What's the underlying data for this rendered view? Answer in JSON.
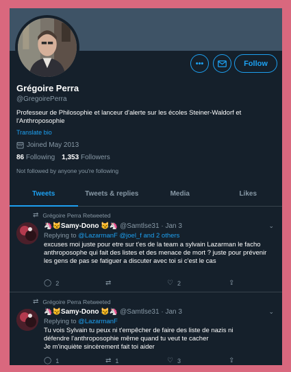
{
  "profile": {
    "display_name": "Grégoire Perra",
    "handle": "@GregoirePerra",
    "bio": "Professeur de Philosophie et lanceur d'alerte sur les écoles Steiner-Waldorf et l'Anthroposophie",
    "translate_label": "Translate bio",
    "joined": "Joined May 2013",
    "following_count": "86",
    "following_label": "Following",
    "followers_count": "1,353",
    "followers_label": "Followers",
    "not_followed": "Not followed by anyone you're following",
    "more_icon": "•••",
    "follow_label": "Follow"
  },
  "tabs": [
    {
      "label": "Tweets"
    },
    {
      "label": "Tweets & replies"
    },
    {
      "label": "Media"
    },
    {
      "label": "Likes"
    }
  ],
  "tweets": [
    {
      "retweeted_by": "Grégoire Perra Retweeted",
      "name": "🦄😼Samy-Dono 😼🦄",
      "meta": "@Samtlse31 · Jan 3",
      "replying_prefix": "Replying to",
      "replying_to": "@LazarmanF @joel_f and 2 others",
      "text": "excuses moi juste pour etre sur t'es de la team a sylvain Lazarman le facho anthroposophe qui fait des listes et des menace de mort ? juste pour prévenir les gens de pas se fatiguer a discuter avec toi si c'est le cas",
      "replies": "2",
      "retweets": "",
      "likes": "2"
    },
    {
      "retweeted_by": "Grégoire Perra Retweeted",
      "name": "🦄😼Samy-Dono 😼🦄",
      "meta": "@Samtlse31 · Jan 3",
      "replying_prefix": "Replying to",
      "replying_to": "@LazarmanF",
      "text_lines": [
        "Tu vois Sylvain tu peux ni t'empêcher de faire des liste de nazis ni",
        "défendre l'anthroposophie même quand tu veut te cacher",
        "Je m'inquiète sincèrement fait toi aider"
      ],
      "replies": "1",
      "retweets": "1",
      "likes": "3"
    }
  ]
}
